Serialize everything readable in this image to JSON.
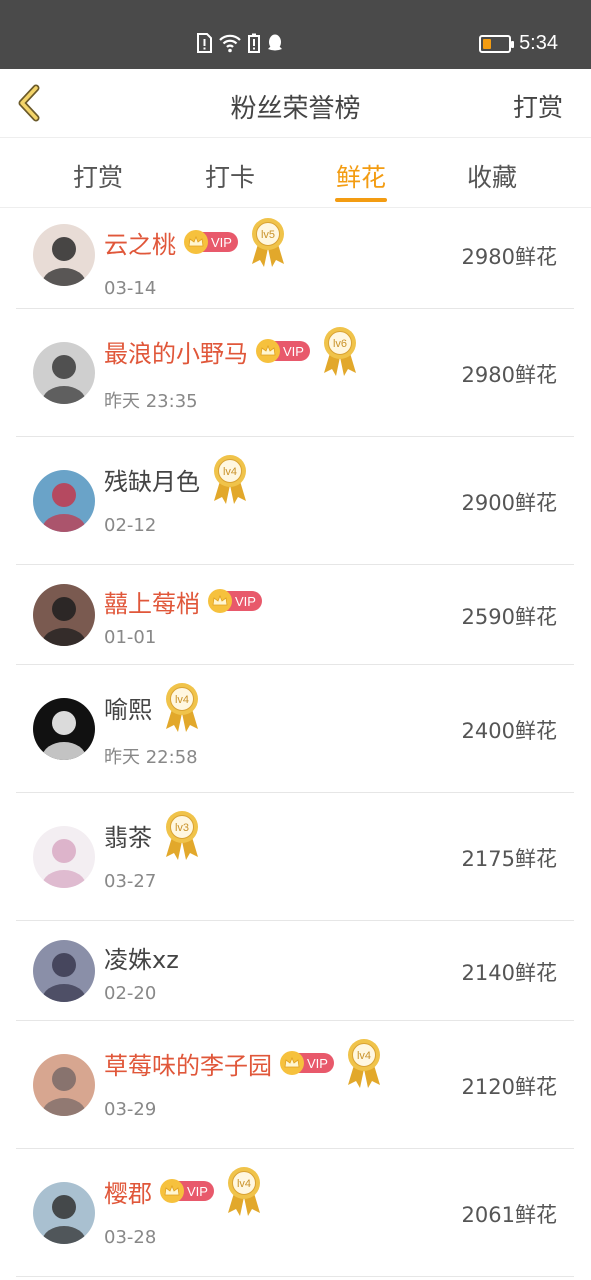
{
  "status_bar": {
    "time": "5:34"
  },
  "nav": {
    "title": "粉丝荣誉榜",
    "right_label": "打赏"
  },
  "tabs": [
    {
      "label": "打赏"
    },
    {
      "label": "打卡"
    },
    {
      "label": "鲜花"
    },
    {
      "label": "收藏"
    }
  ],
  "active_tab": 2,
  "vip_text": "VIP",
  "colors": {
    "accent": "#f39c12",
    "vip_name": "#e0573a",
    "vip_badge": "#e8596b"
  },
  "fans": [
    {
      "name": "云之桃",
      "vip": true,
      "level": "lv5",
      "date": "03-14",
      "amount": "2980鲜花"
    },
    {
      "name": "最浪的小野马",
      "vip": true,
      "level": "lv6",
      "date": "昨天 23:35",
      "amount": "2980鲜花"
    },
    {
      "name": "残缺月色",
      "vip": false,
      "level": "lv4",
      "date": "02-12",
      "amount": "2900鲜花"
    },
    {
      "name": "囍上莓梢",
      "vip": true,
      "level": "",
      "date": "01-01",
      "amount": "2590鲜花"
    },
    {
      "name": "喻熙",
      "vip": false,
      "level": "lv4",
      "date": "昨天 22:58",
      "amount": "2400鲜花"
    },
    {
      "name": "翡茶",
      "vip": false,
      "level": "lv3",
      "date": "03-27",
      "amount": "2175鲜花"
    },
    {
      "name": "凌姝xz",
      "vip": false,
      "level": "",
      "date": "02-20",
      "amount": "2140鲜花"
    },
    {
      "name": "草莓味的李子园",
      "vip": true,
      "level": "lv4",
      "date": "03-29",
      "amount": "2120鲜花"
    },
    {
      "name": "樱郡",
      "vip": true,
      "level": "lv4",
      "date": "03-28",
      "amount": "2061鲜花"
    }
  ]
}
